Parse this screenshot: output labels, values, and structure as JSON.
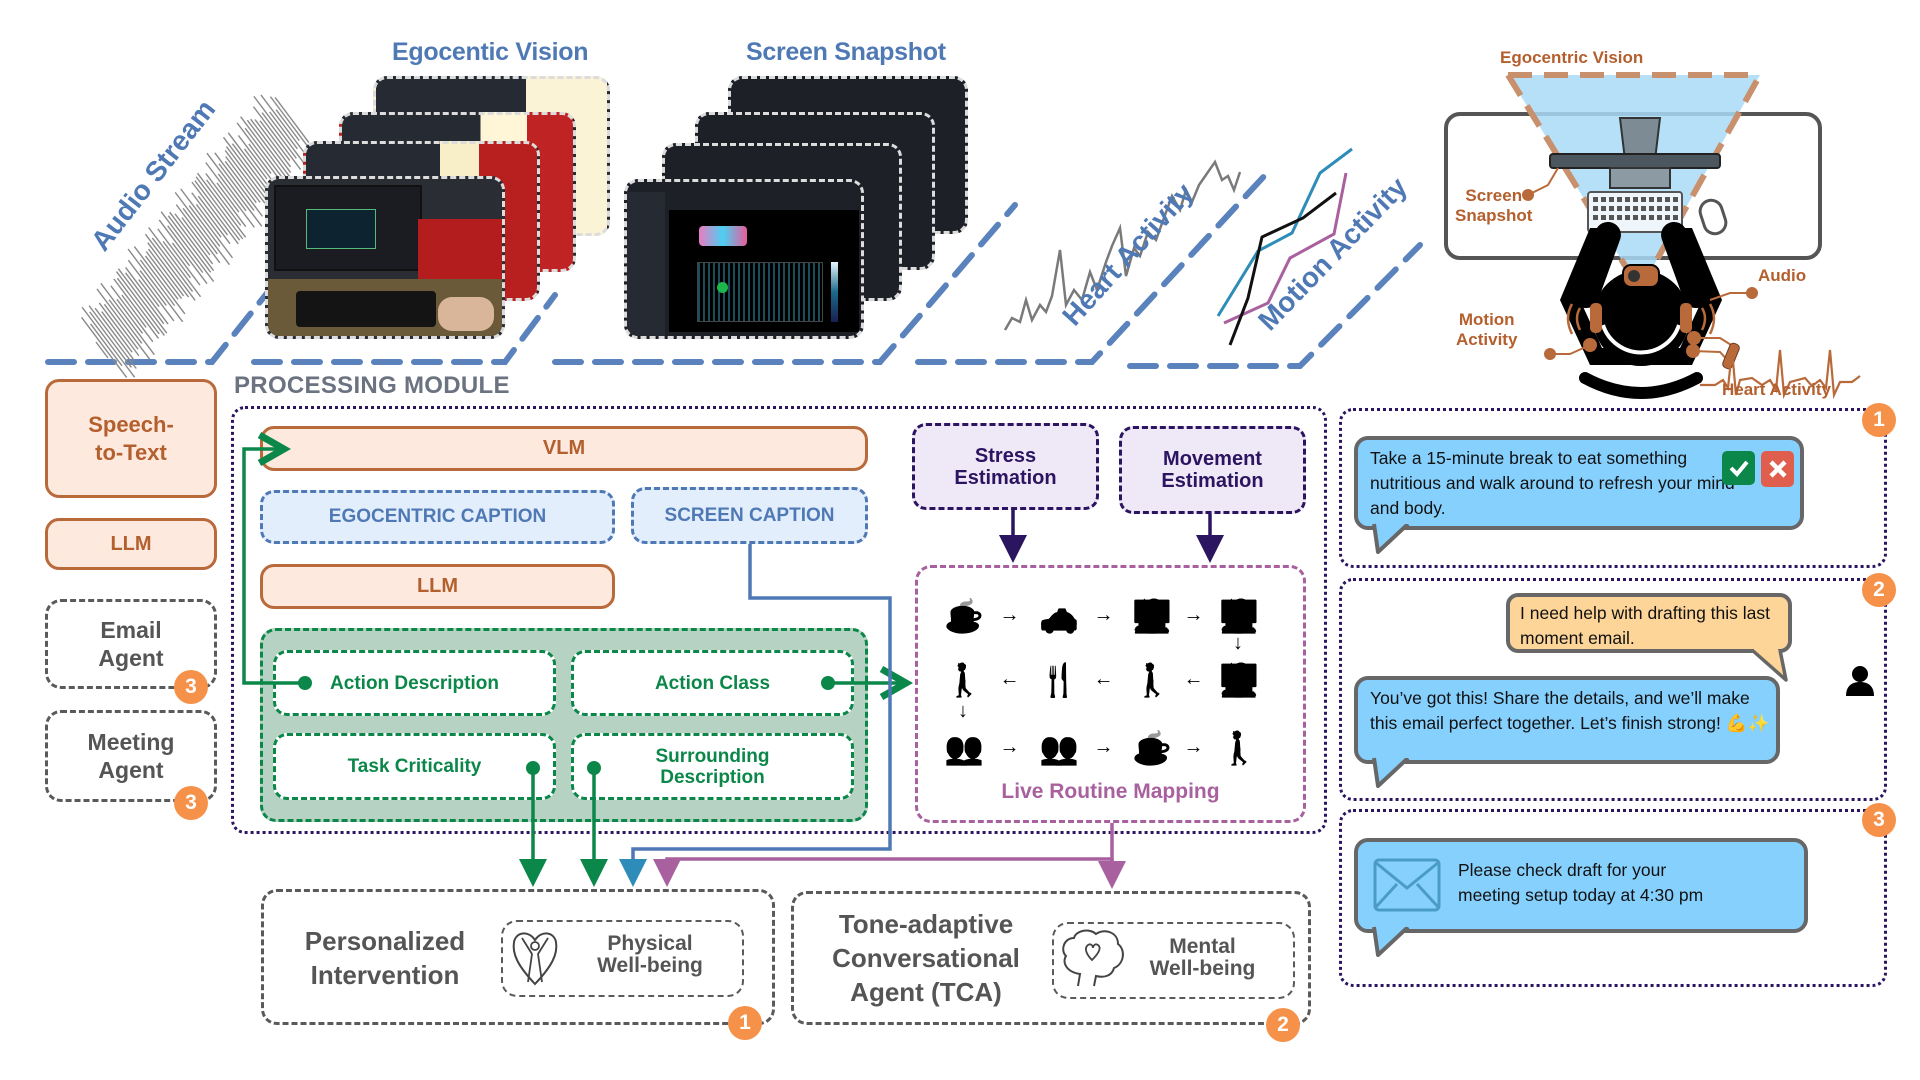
{
  "inputs": {
    "audio_stream_label": "Audio Stream",
    "egocentric_vision_title": "Egocentic Vision",
    "screen_snapshot_title": "Screen Snapshot",
    "heart_activity_label": "Heart Activity",
    "motion_activity_label": "Motion Activity"
  },
  "setup_illustration": {
    "egocentric_vision": "Egocentric Vision",
    "screen_snapshot_line1": "Screen",
    "screen_snapshot_line2": "Snapshot",
    "audio": "Audio",
    "motion_line1": "Motion",
    "motion_line2": "Activity",
    "heart_activity": "Heart Activity"
  },
  "left_column": {
    "speech_to_text_line1": "Speech-",
    "speech_to_text_line2": "to-Text",
    "llm": "LLM",
    "email_agent_line1": "Email",
    "email_agent_line2": "Agent",
    "email_agent_badge": "3",
    "meeting_agent_line1": "Meeting",
    "meeting_agent_line2": "Agent",
    "meeting_agent_badge": "3"
  },
  "processing_module": {
    "title": "PROCESSING MODULE",
    "vlm": "VLM",
    "egocentric_caption": "EGOCENTRIC CAPTION",
    "screen_caption": "SCREEN CAPTION",
    "llm": "LLM",
    "action_description": "Action Description",
    "action_class": "Action Class",
    "task_criticality": "Task Criticality",
    "surrounding_description_line1": "Surrounding",
    "surrounding_description_line2": "Description",
    "stress_estimation_line1": "Stress",
    "stress_estimation_line2": "Estimation",
    "movement_estimation_line1": "Movement",
    "movement_estimation_line2": "Estimation",
    "live_routine_mapping": "Live Routine Mapping",
    "routine_rows": [
      [
        "coffee",
        "taxi",
        "working-at-desk",
        "working-at-desk"
      ],
      [
        "walking",
        "meal",
        "walking",
        "working-at-desk"
      ],
      [
        "meeting",
        "meeting",
        "coffee",
        "walking"
      ]
    ]
  },
  "outputs": {
    "personalized_intervention_line1": "Personalized",
    "personalized_intervention_line2": "Intervention",
    "physical_wellbeing_line1": "Physical",
    "physical_wellbeing_line2": "Well-being",
    "personalized_badge": "1",
    "tca_line1": "Tone-adaptive",
    "tca_line2": "Conversational",
    "tca_line3": "Agent (TCA)",
    "mental_wellbeing_line1": "Mental",
    "mental_wellbeing_line2": "Well-being",
    "tca_badge": "2"
  },
  "examples": {
    "panel1_badge": "1",
    "panel1_message": "Take a 15-minute break to eat something nutritious and walk around to refresh your mind and body.",
    "panel2_badge": "2",
    "panel2_user_message": "I need help with drafting this last moment email.",
    "panel2_agent_message": "You’ve got this! Share the details, and we’ll make this email perfect together. Let’s finish strong! 💪✨",
    "panel3_badge": "3",
    "panel3_message_line1": "Please check draft for your",
    "panel3_message_line2": "meeting setup today at 4:30 pm"
  },
  "colors": {
    "blue": "#4f79b5",
    "orange_border": "#b96a3a",
    "orange_fill": "#fde9dd",
    "green": "#0c874a",
    "green_fill": "#b6d2c2",
    "purple": "#2b1460",
    "magenta": "#a8619e",
    "badge": "#f6914a",
    "bubble_blue": "#86d0fd",
    "bubble_user": "#fdd598"
  }
}
